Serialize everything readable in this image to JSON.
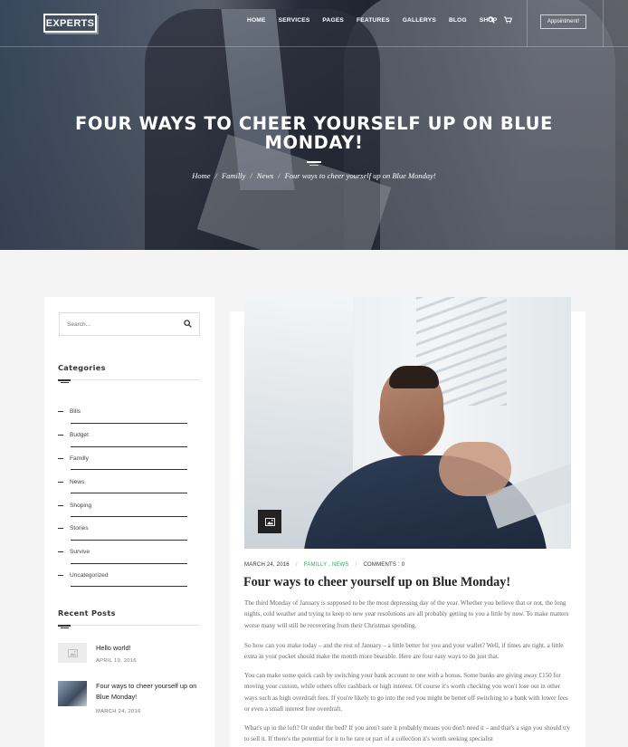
{
  "nav": {
    "logo": "EXPERTS",
    "items": [
      "HOME",
      "SERVICES",
      "PAGES",
      "FEATURES",
      "GALLERYS",
      "BLOG",
      "SHOP"
    ],
    "appointment": "Appointment!"
  },
  "hero": {
    "title": "Four ways to cheer yourself up on Blue Monday!",
    "breadcrumb": [
      "Home",
      "Familly",
      "News",
      "Four ways to cheer yourself up on Blue Monday!"
    ]
  },
  "sidebar": {
    "search_placeholder": "Search...",
    "categories_title": "Categories",
    "categories": [
      "Bills",
      "Budget",
      "Familly",
      "News",
      "Shoping",
      "Stories",
      "Survive",
      "Uncategorized"
    ],
    "recent_title": "Recent Posts",
    "recent_posts": [
      {
        "title": "Hello world!",
        "date": "APRIL 19, 2016"
      },
      {
        "title": "Four ways to cheer yourself up on Blue Monday!",
        "date": "MARCH 24, 2016"
      }
    ]
  },
  "article": {
    "date": "MARCH 24, 2016",
    "categories": "FAMILLY , NEWS",
    "comments": "COMMENTS : 0",
    "title": "Four ways to cheer yourself up on Blue Monday!",
    "paragraphs": [
      "The third Monday of January is supposed to be the most depressing day of the year. Whether you believe that or not, the long nights, cold weather and trying to keep to new year resolutions are all probably getting to you a little by now. To make matters worse many will still be recovering from their Christmas spending.",
      "So how can you make today – and the rest of January – a little better for you and your wallet? Well, if times are tight, a little extra in your pocket should make the month more bearable. Here are four easy ways to do just that.",
      "You can make some quick cash by switching your bank account to one with a bonus. Some banks are giving away £150 for moving your custom, while others offer cashback or high interest. Of course it's worth checking you won't lose out in other ways such as high overdraft fees. If you're likely to go into the red you might be better off switching to a bank with lower fees or even a small interest free overdraft.",
      "What's up in the loft? Or under the bed? If you aren't sure it probably means you don't need it – and that's a sign you should try to sell it. If there's the potential for it to be rare or part of a collection it's worth seeking specialist"
    ]
  }
}
